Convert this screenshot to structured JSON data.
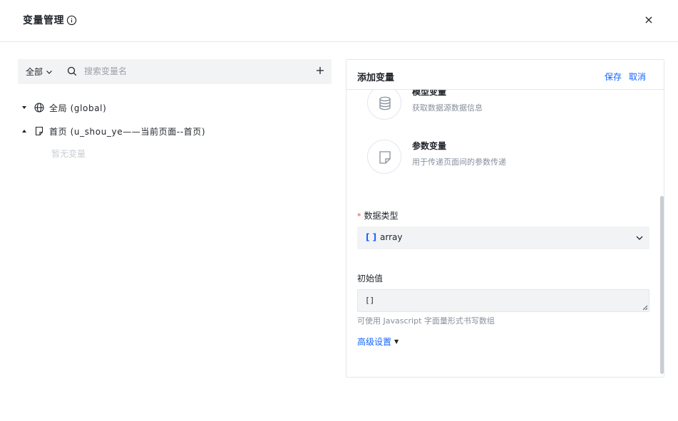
{
  "header": {
    "title": "变量管理",
    "close_label": "×"
  },
  "left": {
    "scope_select": "全部",
    "search": {
      "placeholder": "搜索变量名",
      "value": ""
    },
    "tree": [
      {
        "label": "全局 (global)",
        "expanded": false,
        "icon": "globe-icon"
      },
      {
        "label": "首页 (u_shou_ye——当前页面--首页)",
        "expanded": true,
        "icon": "page-icon"
      }
    ],
    "empty_hint": "暂无变量"
  },
  "right": {
    "title": "添加变量",
    "save_label": "保存",
    "cancel_label": "取消",
    "options": [
      {
        "name": "模型变量",
        "desc": "获取数据源数据信息",
        "icon": "database-icon"
      },
      {
        "name": "参数变量",
        "desc": "用于传递页面间的参数传递",
        "icon": "document-icon"
      }
    ],
    "data_type_label": "数据类型",
    "required_mark": "*",
    "data_type": {
      "icon_text": "[ ]",
      "value": "array"
    },
    "initial_value_label": "初始值",
    "initial_value": "[]",
    "help_text": "可使用 Javascript 字面量形式书写数组",
    "advanced_label": "高级设置"
  },
  "colors": {
    "accent": "#1664ff",
    "required": "#f53f3f",
    "muted": "#86909c",
    "panel_bg": "#f2f3f5"
  }
}
